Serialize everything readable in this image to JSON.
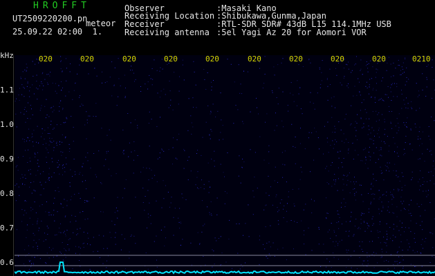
{
  "header": {
    "logo": "HROFFT",
    "filename": "UT2509220200.pn",
    "mode": "meteor",
    "datetime": "25.09.22 02:00  1.",
    "info": [
      {
        "label": "Observer",
        "value": ":Masaki Kano"
      },
      {
        "label": "Receiving Location",
        "value": ":Shibukawa,Gunma,Japan"
      },
      {
        "label": "Receiver",
        "value": ":RTL-SDR SDR# 43dB L15 114.1MHz USB"
      },
      {
        "label": "Receiving antenna",
        "value": ":5el Yagi Az 20 for Aomori VOR"
      }
    ]
  },
  "spectrogram": {
    "unit_label": "kHz",
    "y_ticks": [
      "1.1",
      "1.0",
      "0.9",
      "0.8",
      "0.7",
      "0.6"
    ],
    "time_ticks": [
      "020",
      "020",
      "020",
      "020",
      "020",
      "020",
      "020",
      "020",
      "020",
      "0210"
    ],
    "colors": {
      "background": "#000010",
      "noise": "#2a2acc",
      "trace": "#00e5ff",
      "time_label": "#d8d800"
    }
  }
}
